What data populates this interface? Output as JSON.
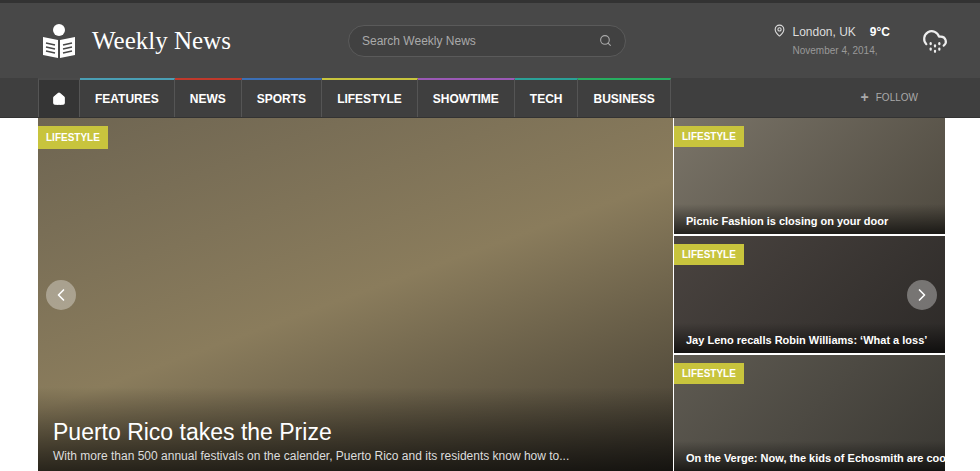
{
  "header": {
    "logo": "Weekly News",
    "search": {
      "placeholder": "Search Weekly News"
    },
    "weather": {
      "location": "London, UK",
      "temperature": "9°C",
      "date": "November 4, 2014,"
    }
  },
  "nav": {
    "items": [
      {
        "label": "",
        "kind": "home",
        "selected": true,
        "color": "#4a4a4a"
      },
      {
        "label": "FEATURES",
        "kind": "text",
        "selected": false,
        "color": "#4a9fb5"
      },
      {
        "label": "NEWS",
        "kind": "text",
        "selected": false,
        "color": "#c0392b"
      },
      {
        "label": "SPORTS",
        "kind": "text",
        "selected": false,
        "color": "#3b6fb6"
      },
      {
        "label": "LIFESTYLE",
        "kind": "text",
        "selected": false,
        "color": "#c8c43d"
      },
      {
        "label": "SHOWTIME",
        "kind": "text",
        "selected": false,
        "color": "#9b59b6"
      },
      {
        "label": "TECH",
        "kind": "text",
        "selected": false,
        "color": "#2aa198"
      },
      {
        "label": "BUSINESS",
        "kind": "text",
        "selected": false,
        "color": "#27ae60"
      }
    ],
    "follow": {
      "glyph": "+",
      "label": "FOLLOW"
    }
  },
  "slider": {
    "category": "LIFESTYLE",
    "title": "Puerto Rico takes the Prize",
    "excerpt": "With more than 500 annual festivals on the calender, Puerto Rico and its residents know how to..."
  },
  "side_cards": [
    {
      "category": "LIFESTYLE",
      "title": "Picnic Fashion is closing on your door"
    },
    {
      "category": "LIFESTYLE",
      "title": "Jay Leno recalls Robin Williams: ‘What a loss’"
    },
    {
      "category": "LIFESTYLE",
      "title": "On the Verge: Now, the kids of Echosmith are cool"
    }
  ]
}
